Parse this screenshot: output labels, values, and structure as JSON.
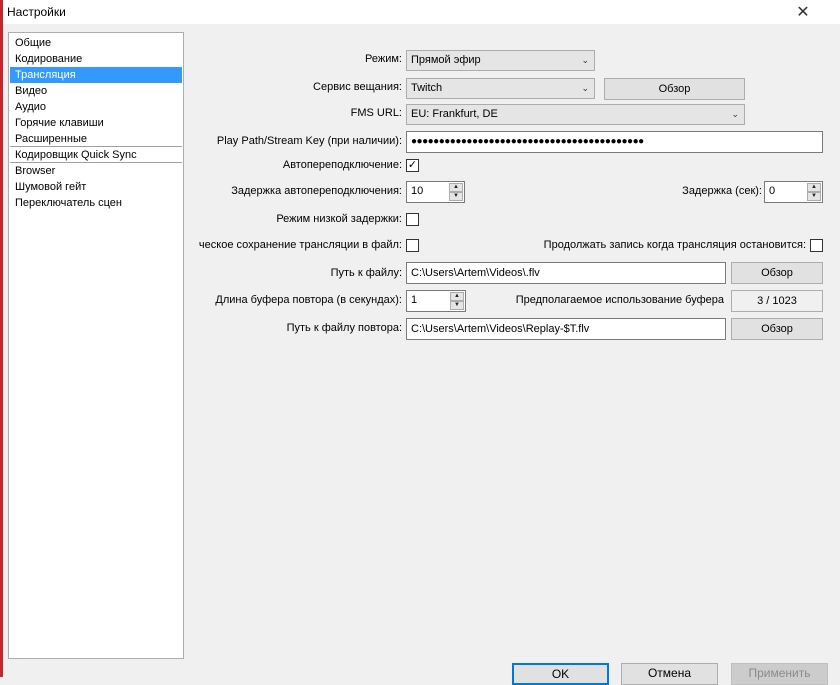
{
  "window": {
    "title": "Настройки",
    "close": "✕"
  },
  "sidebar": {
    "items": [
      {
        "label": "Общие"
      },
      {
        "label": "Кодирование"
      },
      {
        "label": "Трансляция"
      },
      {
        "label": "Видео"
      },
      {
        "label": "Аудио"
      },
      {
        "label": "Горячие клавиши"
      },
      {
        "label": "Расширенные"
      },
      {
        "label": "Кодировщик Quick Sync"
      },
      {
        "label": "Browser"
      },
      {
        "label": "Шумовой гейт"
      },
      {
        "label": "Переключатель сцен"
      }
    ],
    "selected": "Трансляция"
  },
  "form": {
    "mode_label": "Режим:",
    "mode_value": "Прямой эфир",
    "service_label": "Сервис вещания:",
    "service_value": "Twitch",
    "browse1": "Обзор",
    "fms_label": "FMS URL:",
    "fms_value": "EU: Frankfurt, DE",
    "key_label": "Play Path/Stream Key (при наличии):",
    "key_value": "●●●●●●●●●●●●●●●●●●●●●●●●●●●●●●●●●●●●●●●●●●",
    "autoreconnect_label": "Автопереподключение:",
    "autoreconnect_checked": true,
    "check_mark": "✓",
    "reconnect_delay_label": "Задержка автопереподключения:",
    "reconnect_delay_value": "10",
    "delay_label": "Задержка (сек):",
    "delay_value": "0",
    "low_latency_label": "Режим низкой задержки:",
    "autosave_label": "ческое сохранение трансляции в файл:",
    "keep_recording_label": "Продолжать запись когда трансляция остановится:",
    "path_label": "Путь к файлу:",
    "path_value": "C:\\Users\\Artem\\Videos\\.flv",
    "browse2": "Обзор",
    "buffer_label": "Длина буфера повтора (в секундах):",
    "buffer_value": "1",
    "buffer_usage_label": "Предполагаемое использование буфера",
    "buffer_usage_value": "3 / 1023",
    "replay_path_label": "Путь к файлу повтора:",
    "replay_path_value": "C:\\Users\\Artem\\Videos\\Replay-$T.flv",
    "browse3": "Обзор"
  },
  "footer": {
    "ok": "OK",
    "cancel": "Отмена",
    "apply": "Применить"
  },
  "icons": {
    "arrow_down": "⌄",
    "up": "▲",
    "down": "▼"
  }
}
